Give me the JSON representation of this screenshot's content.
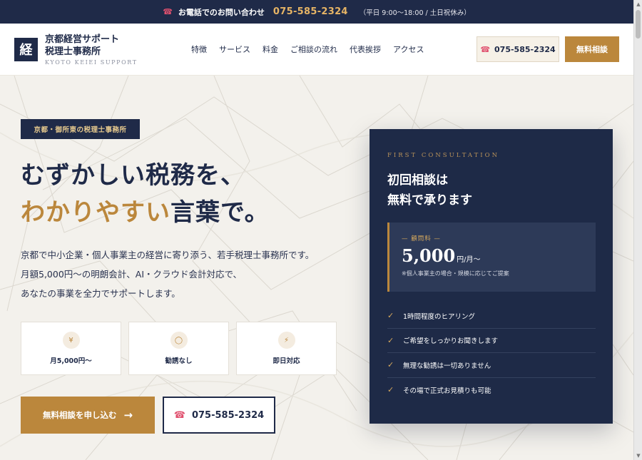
{
  "topbar": {
    "label": "お電話でのお問い合わせ",
    "phone": "075-585-2324",
    "hours": "（平日 9:00〜18:00 / 土日祝休み）"
  },
  "header": {
    "logo_mark": "経",
    "logo_line1": "京都経営サポート",
    "logo_line2": "税理士事務所",
    "logo_en": "KYOTO KEIEI SUPPORT",
    "nav": [
      "特徴",
      "サービス",
      "料金",
      "ご相談の流れ",
      "代表挨拶",
      "アクセス"
    ],
    "tel_label": "075-585-2324",
    "consult_label": "無料相談"
  },
  "hero": {
    "badge": "京都・御所東の税理士事務所",
    "headline_line1": "むずかしい税務を、",
    "headline_accent": "わかりやすい",
    "headline_line2_rest": "言葉で。",
    "lead": [
      "京都で中小企業・個人事業主の経営に寄り添う、若手税理士事務所です。",
      "月額5,000円〜の明朗会計、AI・クラウド会計対応で、",
      "あなたの事業を全力でサポートします。"
    ],
    "features": [
      {
        "icon": "¥",
        "label": "月5,000円〜"
      },
      {
        "icon": "◯",
        "label": "勧誘なし"
      },
      {
        "icon": "⚡",
        "label": "即日対応"
      }
    ],
    "cta_primary": "無料相談を申し込む",
    "cta_primary_arrow": "→",
    "cta_tel": "075-585-2324"
  },
  "card": {
    "eyebrow": "FIRST CONSULTATION",
    "title_line1": "初回相談は",
    "title_line2": "無料で承ります",
    "price_label": "— 顧問料 —",
    "price_value": "5,000",
    "price_unit": "円/月〜",
    "price_note": "※個人事業主の場合・規模に応じてご提案",
    "checklist": [
      "1時間程度のヒアリング",
      "ご希望をしっかりお聞きします",
      "無理な勧誘は一切ありません",
      "その場で正式お見積りも可能"
    ]
  },
  "icons": {
    "phone": "phone-icon",
    "check": "check-icon",
    "yen": "yen-icon",
    "circle": "circle-icon",
    "bolt": "bolt-icon"
  },
  "colors": {
    "navy": "#1f2a48",
    "gold": "#bb873c",
    "phone_pink": "#e0506e"
  }
}
